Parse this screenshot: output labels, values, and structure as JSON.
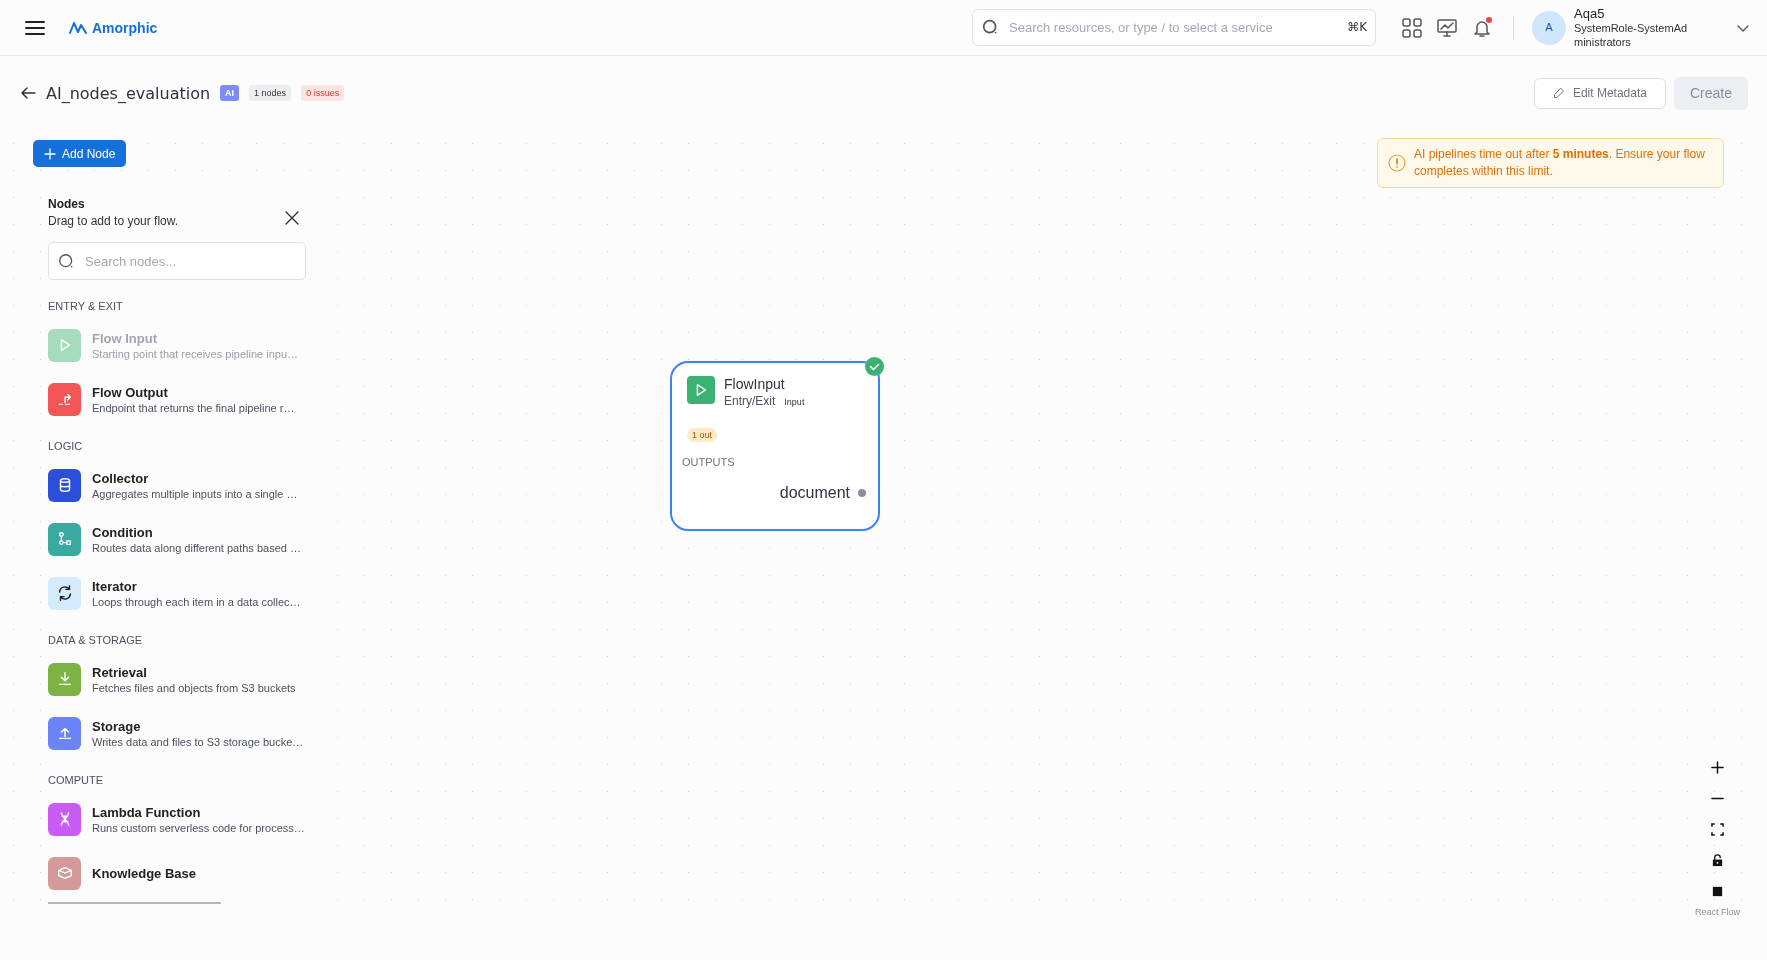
{
  "header": {
    "brand": "Amorphic",
    "search": {
      "placeholder": "Search resources, or type / to select a service",
      "shortcut": "⌘K"
    },
    "notifications_unread": true,
    "user": {
      "initial": "A",
      "name": "Aqa5",
      "role": "SystemRole-SystemAdministrators"
    }
  },
  "title_bar": {
    "title": "AI_nodes_evaluation",
    "badges": [
      {
        "text": "AI",
        "kind": "type"
      },
      {
        "text": "1 nodes",
        "kind": "count"
      },
      {
        "text": "0 issues",
        "kind": "issues"
      }
    ],
    "edit_button": {
      "label": "Edit Metadata"
    },
    "create_button": {
      "label": "Create",
      "disabled": true
    }
  },
  "add_node_button": {
    "label": "Add Node"
  },
  "nodes_panel": {
    "title": "Nodes",
    "subtitle": "Drag to add to your flow.",
    "search": {
      "placeholder": "Search nodes..."
    },
    "sections": [
      {
        "label": "ENTRY & EXIT",
        "items": [
          {
            "name": "Flow Input",
            "description": "Starting point that receives pipeline inpu…",
            "disabled": true,
            "color": "#a6dcbd"
          },
          {
            "name": "Flow Output",
            "description": "Endpoint that returns the final pipeline r…",
            "disabled": false,
            "color": "#f25757"
          }
        ]
      },
      {
        "label": "LOGIC",
        "items": [
          {
            "name": "Collector",
            "description": "Aggregates multiple inputs into a single …",
            "disabled": false,
            "color": "#2b4fd6"
          },
          {
            "name": "Condition",
            "description": "Routes data along different paths based …",
            "disabled": false,
            "color": "#3aa9a0"
          },
          {
            "name": "Iterator",
            "description": "Loops through each item in a data collec…",
            "disabled": false,
            "color": "#d3ebfb"
          }
        ]
      },
      {
        "label": "DATA & STORAGE",
        "items": [
          {
            "name": "Retrieval",
            "description": "Fetches files and objects from S3 buckets",
            "disabled": false,
            "color": "#7cb342"
          },
          {
            "name": "Storage",
            "description": "Writes data and files to S3 storage bucke…",
            "disabled": false,
            "color": "#6b84f7"
          }
        ]
      },
      {
        "label": "COMPUTE",
        "items": [
          {
            "name": "Lambda Function",
            "description": "Runs custom serverless code for process…",
            "disabled": false,
            "color": "#c95cf5"
          },
          {
            "name": "Knowledge Base",
            "disabled": false,
            "color": "#d49a9a"
          }
        ]
      }
    ]
  },
  "flow_node": {
    "title": "FlowInput",
    "category": "Entry/Exit",
    "type": "Input",
    "valid": true,
    "count_badge": "1 out",
    "section": "OUTPUTS",
    "outputs": [
      "document"
    ]
  },
  "alert": {
    "text": "AI pipelines time out after **5 minutes**. Ensure your flow completes within this limit."
  },
  "controls": {
    "attribution": "React Flow"
  }
}
